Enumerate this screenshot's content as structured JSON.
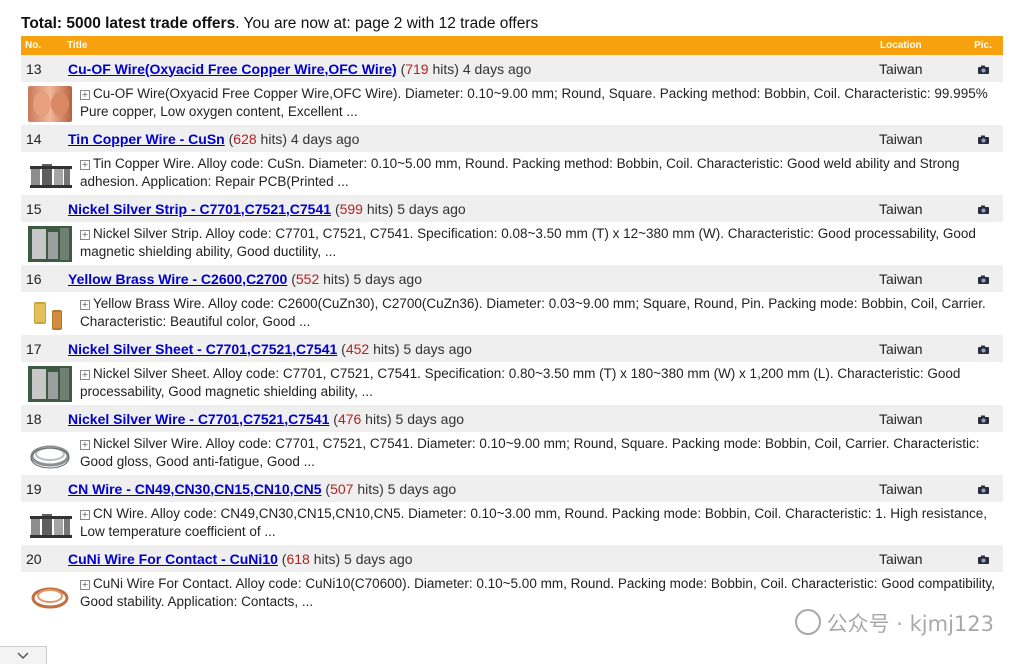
{
  "summary": {
    "bold": "Total: 5000 latest trade offers",
    "rest": ". You are now at: page 2 with 12 trade offers"
  },
  "header": {
    "no": "No.",
    "title": "Title",
    "location": "Location",
    "pic": "Pic."
  },
  "offers": [
    {
      "no": "13",
      "title": "Cu-OF Wire(Oxyacid Free Copper Wire,OFC Wire)",
      "hits_open": "(",
      "hits": "719",
      "hits_close": " hits) 4 days ago",
      "location": "Taiwan",
      "description": "Cu-OF Wire(Oxyacid Free Copper Wire,OFC Wire). Diameter: 0.10~9.00 mm; Round, Square. Packing method: Bobbin, Coil. Characteristic: 99.995% Pure copper, Low oxygen content, Excellent ...",
      "thumb": "copper-wire"
    },
    {
      "no": "14",
      "title": "Tin Copper Wire - CuSn",
      "hits_open": "(",
      "hits": "628",
      "hits_close": " hits) 4 days ago",
      "location": "Taiwan",
      "description": "Tin Copper Wire. Alloy code: CuSn. Diameter: 0.10~5.00 mm, Round. Packing method: Bobbin, Coil. Characteristic: Good weld ability and Strong adhesion. Application: Repair PCB(Printed ...",
      "thumb": "bobbins"
    },
    {
      "no": "15",
      "title": "Nickel Silver Strip - C7701,C7521,C7541",
      "hits_open": "(",
      "hits": "599",
      "hits_close": " hits) 5 days ago",
      "location": "Taiwan",
      "description": "Nickel Silver Strip. Alloy code: C7701, C7521, C7541. Specification: 0.08~3.50 mm (T) x 12~380 mm (W). Characteristic: Good processability, Good magnetic shielding ability, Good ductility, ...",
      "thumb": "strip"
    },
    {
      "no": "16",
      "title": "Yellow Brass Wire - C2600,C2700",
      "hits_open": "(",
      "hits": "552",
      "hits_close": " hits) 5 days ago",
      "location": "Taiwan",
      "description": "Yellow Brass Wire. Alloy code: C2600(CuZn30), C2700(CuZn36). Diameter: 0.03~9.00 mm; Square, Round, Pin. Packing mode: Bobbin, Coil, Carrier. Characteristic: Beautiful color, Good ...",
      "thumb": "brass"
    },
    {
      "no": "17",
      "title": "Nickel Silver Sheet - C7701,C7521,C7541",
      "hits_open": "(",
      "hits": "452",
      "hits_close": " hits) 5 days ago",
      "location": "Taiwan",
      "description": "Nickel Silver Sheet. Alloy code: C7701, C7521, C7541. Specification: 0.80~3.50 mm (T) x 180~380 mm (W) x 1,200 mm (L). Characteristic: Good processability, Good magnetic shielding ability, ...",
      "thumb": "strip"
    },
    {
      "no": "18",
      "title": "Nickel Silver Wire - C7701,C7521,C7541",
      "hits_open": "(",
      "hits": "476",
      "hits_close": " hits) 5 days ago",
      "location": "Taiwan",
      "description": "Nickel Silver Wire. Alloy code: C7701, C7521, C7541. Diameter: 0.10~9.00 mm; Round, Square. Packing mode: Bobbin, Coil, Carrier. Characteristic: Good gloss, Good anti-fatigue, Good ...",
      "thumb": "silver-coil"
    },
    {
      "no": "19",
      "title": "CN Wire - CN49,CN30,CN15,CN10,CN5",
      "hits_open": "(",
      "hits": "507",
      "hits_close": " hits) 5 days ago",
      "location": "Taiwan",
      "description": "CN Wire. Alloy code: CN49,CN30,CN15,CN10,CN5. Diameter: 0.10~3.00 mm, Round. Packing mode: Bobbin, Coil. Characteristic: 1. High resistance, Low temperature coefficient of ...",
      "thumb": "bobbins"
    },
    {
      "no": "20",
      "title": "CuNi Wire For Contact - CuNi10",
      "hits_open": "(",
      "hits": "618",
      "hits_close": " hits) 5 days ago",
      "location": "Taiwan",
      "description": "CuNi Wire For Contact. Alloy code: CuNi10(C70600). Diameter: 0.10~5.00 mm, Round. Packing mode: Bobbin, Coil. Characteristic: Good compatibility, Good stability. Application: Contacts, ...",
      "thumb": "copper-coil"
    }
  ],
  "watermark": "公众号 · kjmj123",
  "colors": {
    "header_bg": "#f7a10e",
    "row_bg": "#efefef",
    "link": "#0000cc",
    "hits": "#b22222"
  },
  "icons": {
    "pic": "camera-icon",
    "expand": "plus-box-icon",
    "scroll": "chevron-down-icon"
  }
}
